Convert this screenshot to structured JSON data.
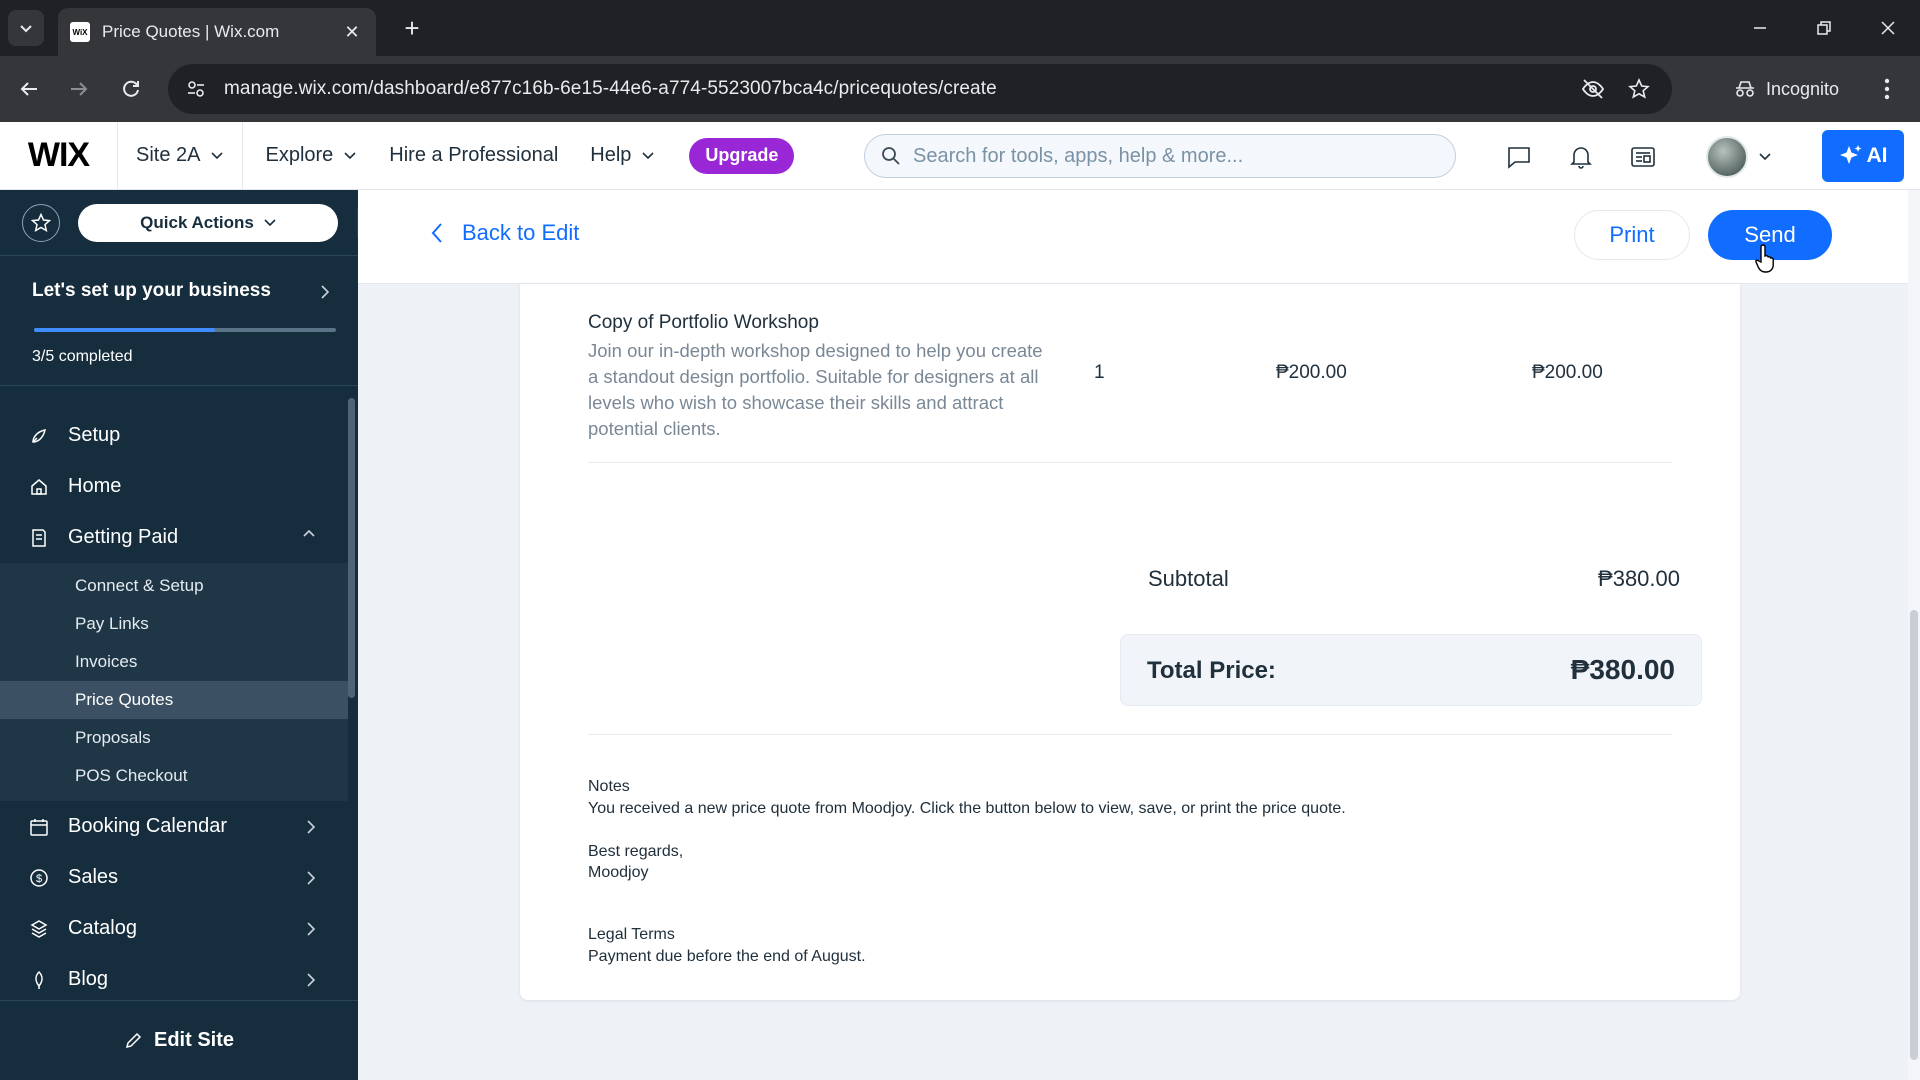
{
  "browser": {
    "tab_title": "Price Quotes | Wix.com",
    "favicon_text": "WiX",
    "url": "manage.wix.com/dashboard/e877c16b-6e15-44e6-a774-5523007bca4c/pricequotes/create",
    "incognito_label": "Incognito"
  },
  "topbar": {
    "logo": "WIX",
    "site_name": "Site 2A",
    "explore": "Explore",
    "hire": "Hire a Professional",
    "help": "Help",
    "upgrade": "Upgrade",
    "search_placeholder": "Search for tools, apps, help & more...",
    "ai_label": "AI",
    "accent_color": "#116dff",
    "upgrade_color": "#9a27d5"
  },
  "sidebar": {
    "quick_actions": "Quick Actions",
    "setup_title": "Let's set up your business",
    "setup_progress": "3/5 completed",
    "setup_fraction": 0.6,
    "items": [
      {
        "label": "Setup",
        "icon": "rocket-icon"
      },
      {
        "label": "Home",
        "icon": "home-icon"
      },
      {
        "label": "Getting Paid",
        "icon": "receipt-icon"
      }
    ],
    "sub_items": [
      "Connect & Setup",
      "Pay Links",
      "Invoices",
      "Price Quotes",
      "Proposals",
      "POS Checkout"
    ],
    "active_sub_item": "Price Quotes",
    "more_items": [
      {
        "label": "Booking Calendar",
        "icon": "calendar-icon"
      },
      {
        "label": "Sales",
        "icon": "dollar-icon"
      },
      {
        "label": "Catalog",
        "icon": "catalog-icon"
      },
      {
        "label": "Blog",
        "icon": "pen-nib-icon"
      }
    ],
    "edit_site": "Edit Site"
  },
  "header": {
    "back": "Back to Edit",
    "print": "Print",
    "send": "Send"
  },
  "quote": {
    "item": {
      "name": "Copy of Portfolio Workshop",
      "description": "Join our in-depth workshop designed to help you create a standout design portfolio. Suitable for designers at all levels who wish to showcase their skills and attract potential clients.",
      "quantity": "1",
      "price": "₱200.00",
      "total": "₱200.00"
    },
    "subtotal_label": "Subtotal",
    "subtotal_value": "₱380.00",
    "total_label": "Total Price:",
    "total_value": "₱380.00",
    "notes_title": "Notes",
    "notes_text": "You received a new price quote from Moodjoy. Click the button below to view, save, or print the price quote.",
    "regards_line1": "Best regards,",
    "regards_line2": "Moodjoy",
    "legal_title": "Legal Terms",
    "legal_text": "Payment due before the end of August."
  }
}
